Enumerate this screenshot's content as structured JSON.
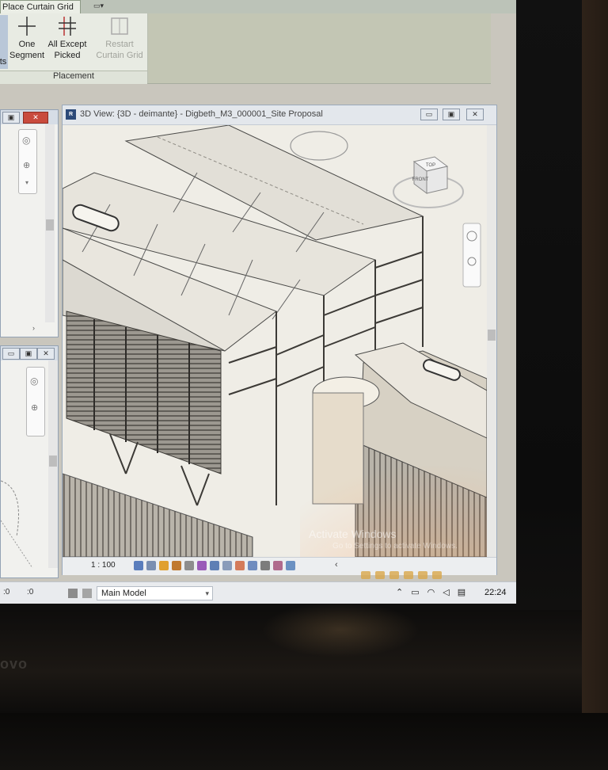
{
  "ribbon": {
    "active_tab": "Place Curtain Grid",
    "buttons": [
      {
        "label_line1": "One",
        "label_line2": "Segment",
        "enabled": true
      },
      {
        "label_line1": "All Except",
        "label_line2": "Picked",
        "enabled": true
      },
      {
        "label_line1": "Restart",
        "label_line2": "Curtain Grid",
        "enabled": false
      }
    ],
    "left_cut_label": "ts",
    "panel_label": "Placement"
  },
  "main_view": {
    "title": "3D View: {3D - deimante} - Digbeth_M3_000001_Site Proposal",
    "viewcube_top": "TOP",
    "viewcube_front": "FRONT",
    "scale": "1 : 100"
  },
  "watermark": {
    "line1": "Activate Windows",
    "line2": "Go to Settings to activate Windows."
  },
  "status_bar": {
    "left_value": ":0",
    "filter_value": ":0",
    "model": "Main Model"
  },
  "taskbar": {
    "time": "22:24"
  },
  "colors": {
    "close_button": "#c94b3d",
    "ribbon_bg": "#e8ebe3",
    "canvas_bg": "#f1efe8"
  }
}
